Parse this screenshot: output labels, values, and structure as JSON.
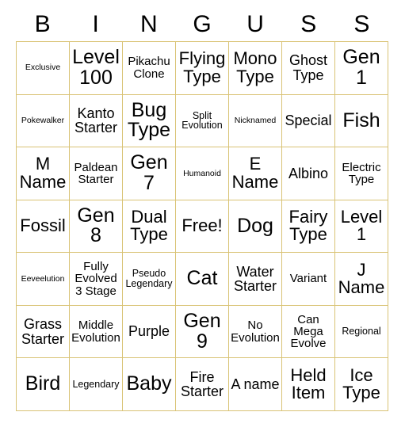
{
  "card": {
    "title_letters": [
      "B",
      "I",
      "N",
      "G",
      "U",
      "S",
      "S"
    ],
    "border_color": "#d9c375",
    "background_color": "#ffffff",
    "text_color": "#000000",
    "rows": 7,
    "columns": 7,
    "free_space": "Free!",
    "cells": [
      [
        {
          "text": "Exclusive",
          "size": "xs"
        },
        {
          "text": "Level 100",
          "size": "xxl"
        },
        {
          "text": "Pikachu Clone",
          "size": "m"
        },
        {
          "text": "Flying Type",
          "size": "xl"
        },
        {
          "text": "Mono Type",
          "size": "xl"
        },
        {
          "text": "Ghost Type",
          "size": "l"
        },
        {
          "text": "Gen 1",
          "size": "xxl"
        }
      ],
      [
        {
          "text": "Pokewalker",
          "size": "xs"
        },
        {
          "text": "Kanto Starter",
          "size": "l"
        },
        {
          "text": "Bug Type",
          "size": "xxl"
        },
        {
          "text": "Split Evolution",
          "size": "s"
        },
        {
          "text": "Nicknamed",
          "size": "xs"
        },
        {
          "text": "Special",
          "size": "l"
        },
        {
          "text": "Fish",
          "size": "xxl"
        }
      ],
      [
        {
          "text": "M Name",
          "size": "xl"
        },
        {
          "text": "Paldean Starter",
          "size": "m"
        },
        {
          "text": "Gen 7",
          "size": "xxl"
        },
        {
          "text": "Humanoid",
          "size": "xs"
        },
        {
          "text": "E Name",
          "size": "xl"
        },
        {
          "text": "Albino",
          "size": "l"
        },
        {
          "text": "Electric Type",
          "size": "m"
        }
      ],
      [
        {
          "text": "Fossil",
          "size": "xl"
        },
        {
          "text": "Gen 8",
          "size": "xxl"
        },
        {
          "text": "Dual Type",
          "size": "xl"
        },
        {
          "text": "Free!",
          "size": "xl"
        },
        {
          "text": "Dog",
          "size": "xxl"
        },
        {
          "text": "Fairy Type",
          "size": "xl"
        },
        {
          "text": "Level 1",
          "size": "xl"
        }
      ],
      [
        {
          "text": "Eeveelution",
          "size": "xs"
        },
        {
          "text": "Fully Evolved 3 Stage",
          "size": "m"
        },
        {
          "text": "Pseudo Legendary",
          "size": "s"
        },
        {
          "text": "Cat",
          "size": "xxl"
        },
        {
          "text": "Water Starter",
          "size": "l"
        },
        {
          "text": "Variant",
          "size": "m"
        },
        {
          "text": "J Name",
          "size": "xl"
        }
      ],
      [
        {
          "text": "Grass Starter",
          "size": "l"
        },
        {
          "text": "Middle Evolution",
          "size": "m"
        },
        {
          "text": "Purple",
          "size": "l"
        },
        {
          "text": "Gen 9",
          "size": "xxl"
        },
        {
          "text": "No Evolution",
          "size": "m"
        },
        {
          "text": "Can Mega Evolve",
          "size": "m"
        },
        {
          "text": "Regional",
          "size": "s"
        }
      ],
      [
        {
          "text": "Bird",
          "size": "xxl"
        },
        {
          "text": "Legendary",
          "size": "s"
        },
        {
          "text": "Baby",
          "size": "xxl"
        },
        {
          "text": "Fire Starter",
          "size": "l"
        },
        {
          "text": "A name",
          "size": "l"
        },
        {
          "text": "Held Item",
          "size": "xl"
        },
        {
          "text": "Ice Type",
          "size": "xl"
        }
      ]
    ]
  }
}
